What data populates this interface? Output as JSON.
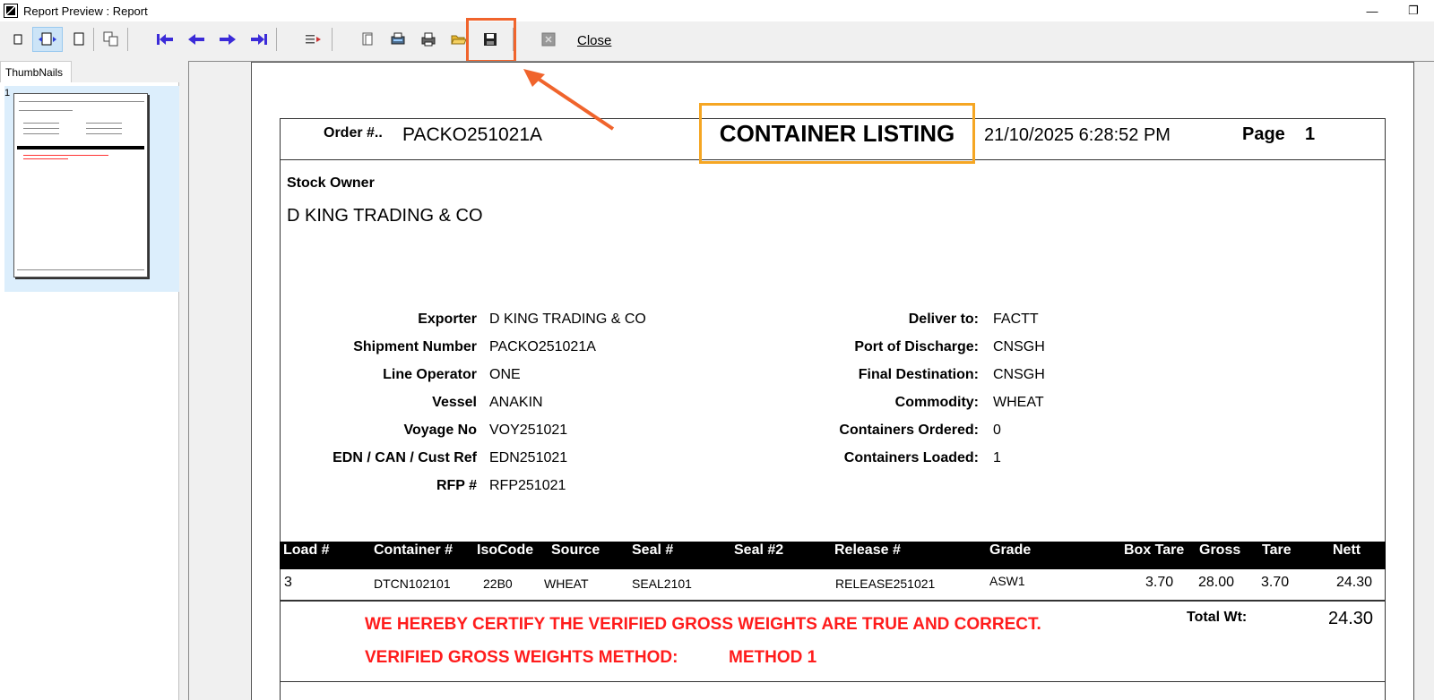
{
  "window": {
    "title": "Report Preview : Report",
    "minimize": "—",
    "restore": "❐"
  },
  "toolbar": {
    "close_label": "Close"
  },
  "thumbnails": {
    "tab_label": "ThumbNails",
    "page_number": "1"
  },
  "report": {
    "order_label": "Order #..",
    "order_value": "PACKO251021A",
    "title": "CONTAINER LISTING",
    "datetime": "21/10/2025 6:28:52 PM",
    "page_label": "Page",
    "page_value": "1",
    "stock_owner_label": "Stock Owner",
    "stock_owner_value": "D KING TRADING & CO",
    "left_fields": [
      {
        "label": "Exporter",
        "value": "D KING TRADING & CO"
      },
      {
        "label": "Shipment Number",
        "value": "PACKO251021A"
      },
      {
        "label": "Line Operator",
        "value": "ONE"
      },
      {
        "label": "Vessel",
        "value": "ANAKIN"
      },
      {
        "label": "Voyage No",
        "value": "VOY251021"
      },
      {
        "label": "EDN / CAN / Cust Ref",
        "value": "EDN251021"
      },
      {
        "label": "RFP #",
        "value": "RFP251021"
      }
    ],
    "right_fields": [
      {
        "label": "Deliver to:",
        "value": "FACTT"
      },
      {
        "label": "Port of Discharge:",
        "value": "CNSGH"
      },
      {
        "label": "Final Destination:",
        "value": "CNSGH"
      },
      {
        "label": "Commodity:",
        "value": "WHEAT"
      },
      {
        "label": "Containers Ordered:",
        "value": "0"
      },
      {
        "label": "Containers Loaded:",
        "value": "1"
      }
    ],
    "table": {
      "headers": [
        "Load #",
        "Container #",
        "IsoCode",
        "Source",
        "Seal #",
        "Seal #2",
        "Release #",
        "Grade",
        "Box Tare",
        "Gross",
        "Tare",
        "Nett"
      ],
      "rows": [
        [
          "3",
          "DTCN102101",
          "22B0",
          "WHEAT",
          "SEAL2101",
          "",
          "RELEASE251021",
          "ASW1",
          "3.70",
          "28.00",
          "3.70",
          "24.30"
        ]
      ]
    },
    "total_label": "Total Wt:",
    "total_value": "24.30",
    "cert_line1": "WE HEREBY CERTIFY THE VERIFIED GROSS WEIGHTS ARE TRUE AND CORRECT.",
    "cert_line2_label": "VERIFIED GROSS WEIGHTS METHOD:",
    "cert_line2_value": "METHOD 1"
  },
  "colors": {
    "highlight_save": "#f0642c",
    "highlight_title": "#f5a623",
    "nav_arrows": "#3b2bd8",
    "cert_text": "#ff1c1c"
  }
}
